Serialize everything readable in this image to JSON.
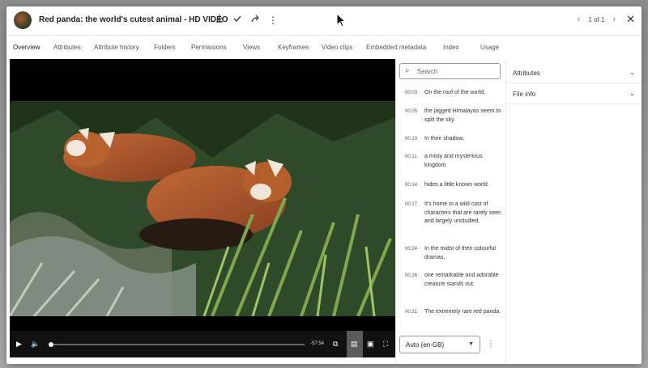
{
  "header": {
    "title": "Red panda: the world's cutest animal - HD VIDEO",
    "pager": "1 of 1",
    "icons": [
      "download-icon",
      "check-icon",
      "share-icon",
      "kebab-icon"
    ]
  },
  "tabs": [
    {
      "label": "Overview",
      "active": true
    },
    {
      "label": "Attributes"
    },
    {
      "label": "Attribute history"
    },
    {
      "label": "Folders"
    },
    {
      "label": "Permissions"
    },
    {
      "label": "Views"
    },
    {
      "label": "Keyframes"
    },
    {
      "label": "Video clips"
    },
    {
      "label": "Embedded metadata"
    },
    {
      "label": "Index"
    },
    {
      "label": "Usage"
    }
  ],
  "player": {
    "time_remaining": "-57:54",
    "progress": 0.0,
    "controls": [
      "play-icon",
      "volume-icon",
      "captions-icon",
      "transcript-icon",
      "pip-icon",
      "fullscreen-icon"
    ]
  },
  "transcript": {
    "search_placeholder": "Search",
    "cues": [
      {
        "time": "00:03",
        "text": "On the roof of the world,"
      },
      {
        "time": "00:05",
        "text": "the jagged Himalayas seem to split the sky."
      },
      {
        "time": "00:10",
        "text": "In their shadow,"
      },
      {
        "time": "00:11",
        "text": "a misty and mysterious kingdom"
      },
      {
        "time": "00:14",
        "text": "hides a little known world."
      },
      {
        "time": "00:17",
        "text": "It's home to a wild cast of characters that are rarely seen and largely unstudied."
      },
      {
        "time": "00:24",
        "text": "In the midst of their colourful dramas,"
      },
      {
        "time": "00:26",
        "text": "one remarkable and adorable creature stands out."
      },
      {
        "time": "00:31",
        "text": "The extremely rare red panda."
      }
    ],
    "language": "Auto (en-GB)"
  },
  "side_panel": {
    "sections": [
      {
        "label": "Attributes"
      },
      {
        "label": "File info"
      }
    ]
  },
  "colors": {
    "accent": "#2c7be5",
    "panda": "#b05a2e"
  }
}
